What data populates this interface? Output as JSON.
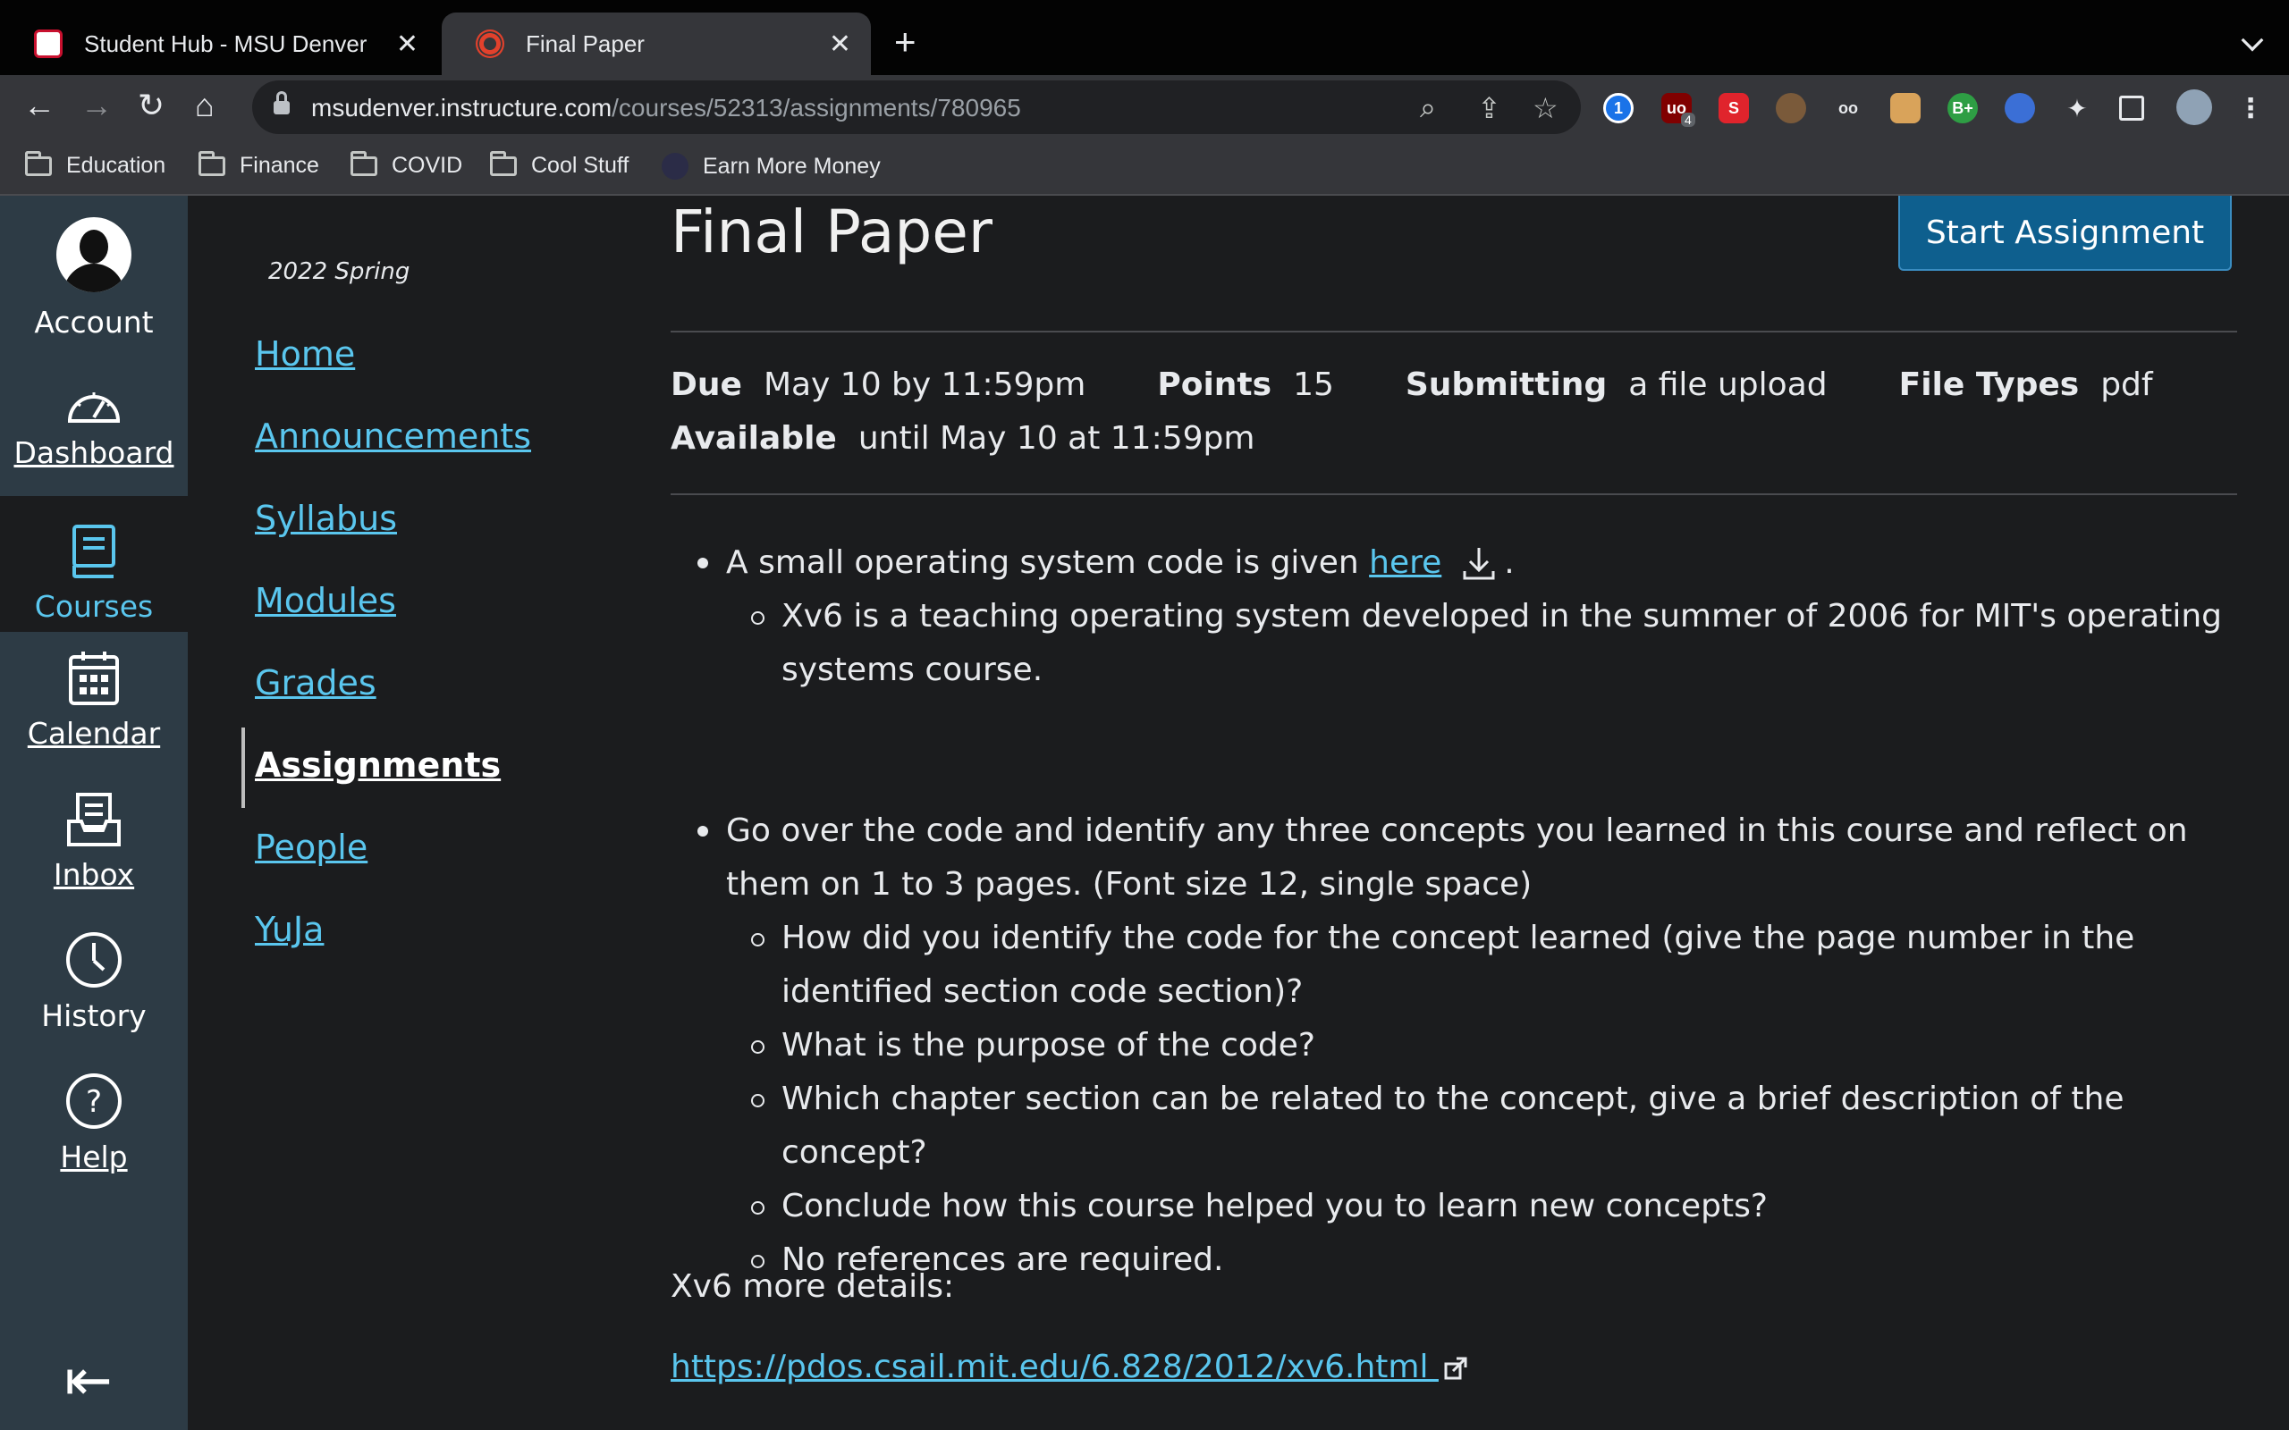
{
  "browser": {
    "tabs": [
      {
        "title": "Student Hub - MSU Denver",
        "active": false,
        "favicon": "msu-denver-favicon"
      },
      {
        "title": "Final Paper",
        "active": true,
        "favicon": "canvas-favicon"
      }
    ],
    "new_tab_icon": "+",
    "url_host": "msudenver.instructure.com",
    "url_path": "/courses/52313/assignments/780965",
    "extension_badge": "4",
    "bookmarks": [
      {
        "label": "Education",
        "icon": "folder-icon"
      },
      {
        "label": "Finance",
        "icon": "folder-icon"
      },
      {
        "label": "COVID",
        "icon": "folder-icon"
      },
      {
        "label": "Cool Stuff",
        "icon": "folder-icon"
      },
      {
        "label": "Earn More Money",
        "icon": "site-icon"
      }
    ]
  },
  "global_nav": {
    "items": [
      {
        "label": "Account",
        "icon": "avatar"
      },
      {
        "label": "Dashboard",
        "icon": "dashboard-icon"
      },
      {
        "label": "Courses",
        "icon": "courses-icon",
        "active": true
      },
      {
        "label": "Calendar",
        "icon": "calendar-icon"
      },
      {
        "label": "Inbox",
        "icon": "inbox-icon"
      },
      {
        "label": "History",
        "icon": "history-icon"
      },
      {
        "label": "Help",
        "icon": "help-icon"
      }
    ]
  },
  "course_nav": {
    "term": "2022 Spring",
    "links": [
      "Home",
      "Announcements",
      "Syllabus",
      "Modules",
      "Grades",
      "Assignments",
      "People",
      "YuJa"
    ],
    "active": "Assignments"
  },
  "assignment": {
    "title": "Final Paper",
    "start_button": "Start Assignment",
    "due_label": "Due",
    "due_value": "May 10 by 11:59pm",
    "points_label": "Points",
    "points_value": "15",
    "submitting_label": "Submitting",
    "submitting_value": "a file upload",
    "file_types_label": "File Types",
    "file_types_value": "pdf",
    "available_label": "Available",
    "available_value": "until May 10 at 11:59pm",
    "bullet1_prefix": "A small operating system code is given ",
    "bullet1_link": "here",
    "bullet1_suffix": ".",
    "bullet1_sub": "Xv6 is a teaching operating system developed in the summer of 2006 for MIT's operating systems course.",
    "bullet2": "Go over the code and identify any three concepts you learned in this course and reflect on them on 1 to 3 pages. (Font size 12, single space)",
    "bullet2_subs": [
      "How did you identify the code for the concept learned (give the page number in the identified section code section)?",
      "What is the purpose of the code?",
      "Which chapter section can be related to the concept, give a brief description of the concept?",
      "Conclude how this course helped you to learn new concepts?",
      "No references are required."
    ],
    "more_details": "Xv6 more details:",
    "details_link": "https://pdos.csail.mit.edu/6.828/2012/xv6.html "
  }
}
